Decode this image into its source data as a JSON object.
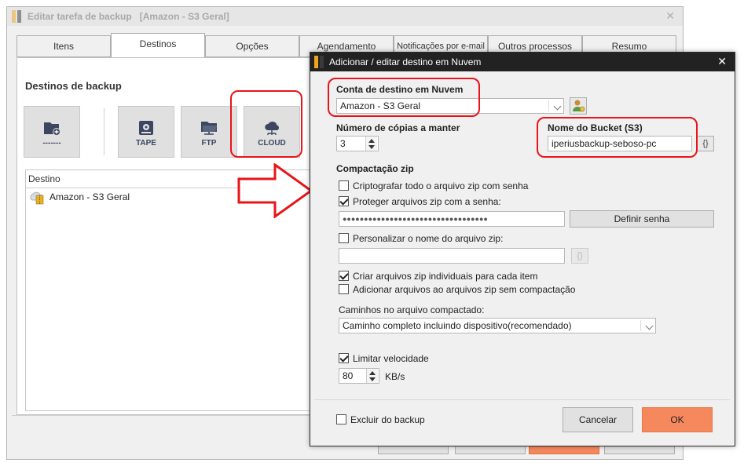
{
  "background_window": {
    "title": "Editar tarefa de backup",
    "subtitle": "[Amazon - S3 Geral]",
    "tabs": [
      {
        "label": "Itens",
        "active": false
      },
      {
        "label": "Destinos",
        "active": true
      },
      {
        "label": "Opções",
        "active": false
      },
      {
        "label": "Agendamento",
        "active": false
      },
      {
        "label": "Notificações por e-mail",
        "active": false
      },
      {
        "label": "Outros processos",
        "active": false
      },
      {
        "label": "Resumo",
        "active": false
      }
    ],
    "section_title": "Destinos de backup",
    "destination_buttons": [
      {
        "label": "-------",
        "icon": "folder-add-icon"
      },
      {
        "label": "TAPE",
        "icon": "tape-icon"
      },
      {
        "label": "FTP",
        "icon": "ftp-folder-icon"
      },
      {
        "label": "CLOUD",
        "icon": "cloud-icon"
      }
    ],
    "list_header": "Destino",
    "list_items": [
      {
        "label": "Amazon - S3 Geral",
        "icon": "cloud-zip-icon"
      }
    ]
  },
  "dialog": {
    "title": "Adicionar / editar destino em Nuvem",
    "cloud_account_label": "Conta de destino em Nuvem",
    "cloud_account_value": "Amazon - S3 Geral",
    "copies_label": "Número de cópias a manter",
    "copies_value": "3",
    "bucket_label": "Nome do Bucket (S3)",
    "bucket_value": "iperiusbackup-seboso-pc",
    "braces_label": "{}",
    "zip_section": "Compactação zip",
    "encrypt_label": "Criptografar todo o arquivo zip com senha",
    "encrypt_checked": false,
    "protect_label": "Proteger arquivos zip com a senha:",
    "protect_checked": true,
    "password_mask": "●●●●●●●●●●●●●●●●●●●●●●●●●●●●●●●●●●",
    "set_password_label": "Definir senha",
    "custom_name_label": "Personalizar o nome do arquivo zip:",
    "custom_name_checked": false,
    "custom_name_value": "",
    "individual_zip_label": "Criar arquivos zip individuais para cada item",
    "individual_zip_checked": true,
    "no_compress_label": "Adicionar arquivos ao arquivos zip sem compactação",
    "no_compress_checked": false,
    "paths_label": "Caminhos no arquivo compactado:",
    "paths_value": "Caminho completo incluindo dispositivo(recomendado)",
    "limit_speed_label": "Limitar velocidade",
    "limit_speed_checked": true,
    "speed_value": "80",
    "speed_unit": "KB/s",
    "exclude_label": "Excluir do backup",
    "exclude_checked": false,
    "cancel_label": "Cancelar",
    "ok_label": "OK"
  },
  "colors": {
    "highlight": "#e8141a",
    "ok_button": "#f5895d",
    "dialog_title_bg": "#222222"
  }
}
